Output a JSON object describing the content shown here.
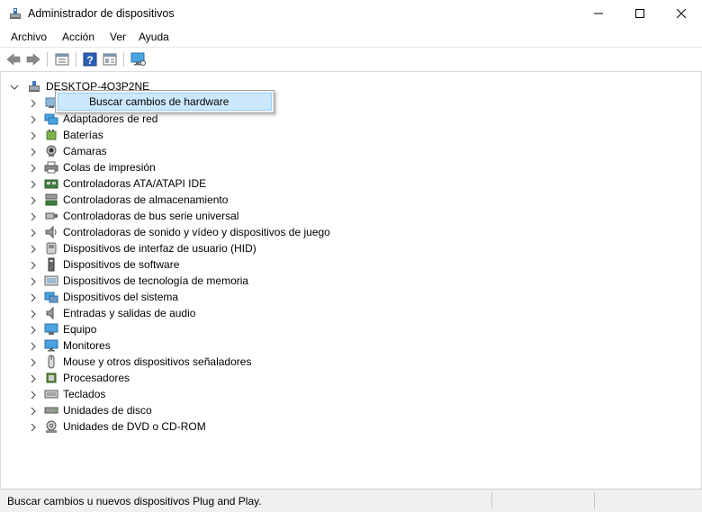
{
  "window": {
    "title": "Administrador de dispositivos",
    "app_icon": "device-manager-icon",
    "controls": [
      "minimize",
      "maximize",
      "close"
    ]
  },
  "menu": {
    "items": [
      "Archivo",
      "Acción",
      "Ver",
      "Ayuda"
    ]
  },
  "toolbar": {
    "buttons": [
      "back-arrow-icon",
      "forward-arrow-icon",
      "properties-icon",
      "help-icon",
      "view-icon",
      "monitor-scan-icon"
    ]
  },
  "tree": {
    "root": "DESKTOP-4O3P2NE",
    "root_expanded": true,
    "items": [
      {
        "label": "",
        "icon": "generic-device-icon"
      },
      {
        "label": "Adaptadores de red",
        "icon": "network-adapter-icon"
      },
      {
        "label": "Baterías",
        "icon": "battery-icon"
      },
      {
        "label": "Cámaras",
        "icon": "camera-icon"
      },
      {
        "label": "Colas de impresión",
        "icon": "printer-icon"
      },
      {
        "label": "Controladoras ATA/ATAPI IDE",
        "icon": "ide-controller-icon"
      },
      {
        "label": "Controladoras de almacenamiento",
        "icon": "storage-controller-icon"
      },
      {
        "label": "Controladoras de bus serie universal",
        "icon": "usb-icon"
      },
      {
        "label": "Controladoras de sonido y vídeo y dispositivos de juego",
        "icon": "speaker-icon"
      },
      {
        "label": "Dispositivos de interfaz de usuario (HID)",
        "icon": "hid-icon"
      },
      {
        "label": "Dispositivos de software",
        "icon": "software-device-icon"
      },
      {
        "label": "Dispositivos de tecnología de memoria",
        "icon": "memory-device-icon"
      },
      {
        "label": "Dispositivos del sistema",
        "icon": "system-device-icon"
      },
      {
        "label": "Entradas y salidas de audio",
        "icon": "audio-io-icon"
      },
      {
        "label": "Equipo",
        "icon": "computer-icon"
      },
      {
        "label": "Monitores",
        "icon": "monitor-icon"
      },
      {
        "label": "Mouse y otros dispositivos señaladores",
        "icon": "mouse-icon"
      },
      {
        "label": "Procesadores",
        "icon": "processor-icon"
      },
      {
        "label": "Teclados",
        "icon": "keyboard-icon"
      },
      {
        "label": "Unidades de disco",
        "icon": "disk-drive-icon"
      },
      {
        "label": "Unidades de DVD o CD-ROM",
        "icon": "dvd-drive-icon"
      }
    ]
  },
  "context_menu": {
    "items": [
      "Buscar cambios de hardware"
    ],
    "highlighted_index": 0
  },
  "status": {
    "text": "Buscar cambios u nuevos dispositivos Plug and Play."
  },
  "colors": {
    "highlight_fill": "#cce8ff",
    "highlight_border": "#99d1ff",
    "status_bar": "#f0f0f0"
  }
}
